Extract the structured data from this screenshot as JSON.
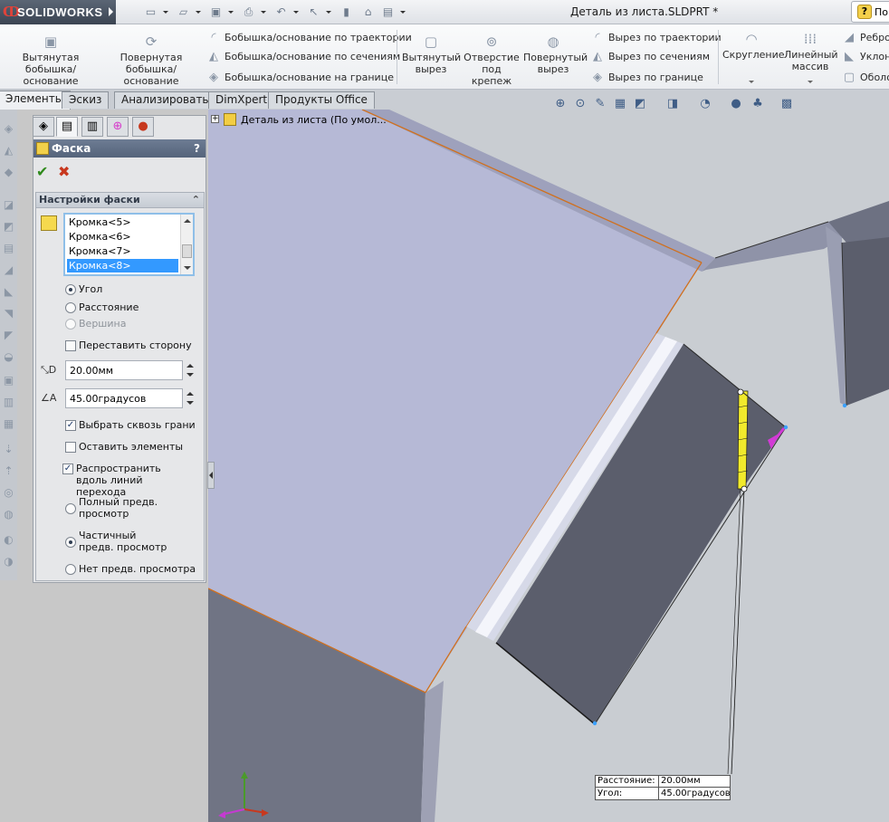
{
  "app": {
    "logo_text": "SOLIDWORKS",
    "document_title": "Деталь из листа.SLDPRT *",
    "help_search_label": "По"
  },
  "ribbon": {
    "extruded_boss": "Вытянутая бобышка/основание",
    "revolved_boss": "Повернутая бобышка/основание",
    "swept_boss": "Бобышка/основание по траектории",
    "lofted_boss": "Бобышка/основание по сечениям",
    "boundary_boss": "Бобышка/основание на границе",
    "extruded_cut": "Вытянутый вырез",
    "hole_wizard": "Отверстие под крепеж",
    "revolved_cut": "Повернутый вырез",
    "swept_cut": "Вырез по траектории",
    "lofted_cut": "Вырез по сечениям",
    "boundary_cut": "Вырез по границе",
    "fillet": "Скругление",
    "linear_pattern": "Линейный массив",
    "rib": "Ребро",
    "draft": "Уклон",
    "shell": "Оболо"
  },
  "tabs": [
    "Элементы",
    "Эскиз",
    "Анализировать",
    "DimXpert",
    "Продукты Office"
  ],
  "tree": {
    "root_label": "Деталь из листа  (По умол..."
  },
  "property_manager": {
    "title": "Фаска",
    "help": "?",
    "group_title": "Настройки фаски",
    "edges": [
      "Кромка<5>",
      "Кромка<6>",
      "Кромка<7>",
      "Кромка<8>"
    ],
    "selected_edge_index": 3,
    "type_options": {
      "angle": "Угол",
      "distance": "Расстояние",
      "vertex": "Вершина"
    },
    "selected_type": "angle",
    "flip_direction": "Переставить сторону",
    "distance_value": "20.00мм",
    "angle_value": "45.00градусов",
    "select_through_faces": "Выбрать сквозь грани",
    "keep_features": "Оставить элементы",
    "tangent_propagation": "Распространить вдоль линий перехода",
    "preview_full": "Полный предв. просмотр",
    "preview_partial": "Частичный предв. просмотр",
    "preview_none": "Нет предв. просмотра",
    "selected_preview": "partial",
    "checks": {
      "flip_direction": false,
      "select_through_faces": true,
      "keep_features": false,
      "tangent_propagation": true
    }
  },
  "callout": {
    "distance_label": "Расстояние:",
    "distance_value": "20.00мм",
    "angle_label": "Угол:",
    "angle_value": "45.00градусов"
  },
  "colors": {
    "part_top_face": "#b6b9d6",
    "part_dark_face": "#5b5e6c",
    "part_side_face": "#707484",
    "edge_highlight": "#d0701e",
    "selection_yellow": "#f1ea2c",
    "arrow_magenta": "#d23ad6",
    "background": "#c9cdd2"
  }
}
